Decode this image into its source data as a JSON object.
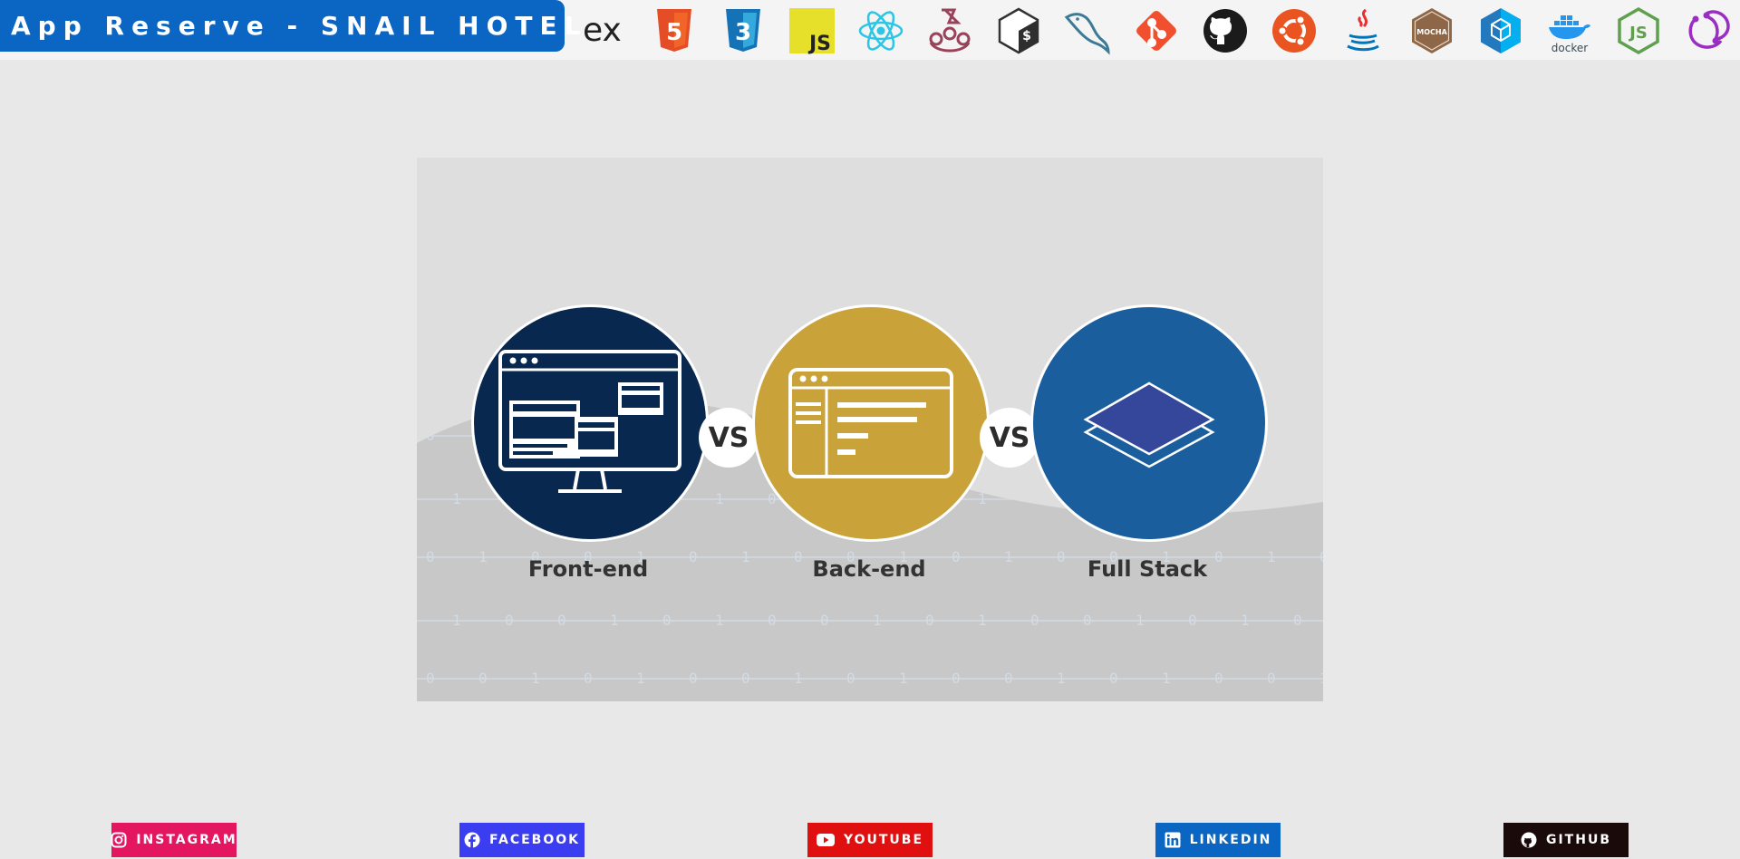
{
  "header": {
    "brand": "App Reserve - SNAIL HOTEL",
    "tech_icons": [
      "express-icon",
      "html5-icon",
      "css3-icon",
      "javascript-icon",
      "react-icon",
      "jest-icon",
      "bash-icon",
      "mysql-icon",
      "git-icon",
      "github-icon",
      "ubuntu-icon",
      "java-icon",
      "mocha-icon",
      "sequelize-icon",
      "docker-icon",
      "nodejs-icon",
      "redux-saga-icon"
    ],
    "tech_text": {
      "express": "ex",
      "javascript": "JS",
      "mocha": "MOCHA",
      "docker": "docker",
      "node": "JS",
      "bash": "$"
    }
  },
  "banner": {
    "items": [
      {
        "label": "Front-end",
        "color": "#08284f"
      },
      {
        "label": "Back-end",
        "color": "#c9a23a"
      },
      {
        "label": "Full Stack",
        "color": "#1a5e9e"
      }
    ],
    "vs": [
      "VS",
      "VS"
    ],
    "binary_rows": [
      "0",
      "1",
      "0",
      "1",
      "0"
    ]
  },
  "footer": {
    "links": [
      {
        "label": "INSTAGRAM",
        "icon": "instagram-icon",
        "color": "#e4165f"
      },
      {
        "label": "FACEBOOK",
        "icon": "facebook-icon",
        "color": "#3b3ef0"
      },
      {
        "label": "YOUTUBE",
        "icon": "youtube-icon",
        "color": "#e01010"
      },
      {
        "label": "LINKEDIN",
        "icon": "linkedin-icon",
        "color": "#0a66c2"
      },
      {
        "label": "GITHUB",
        "icon": "github-icon",
        "color": "#1a0a0a"
      }
    ]
  }
}
